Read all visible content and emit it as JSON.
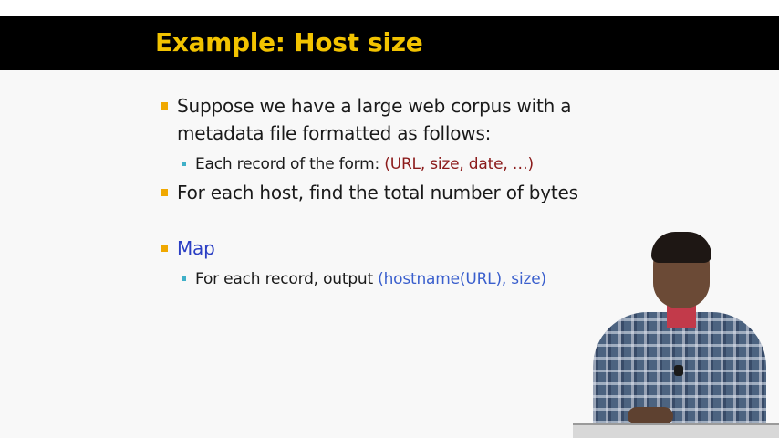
{
  "slide": {
    "title": "Example: Host size",
    "bullets": [
      {
        "line1": "Suppose we have a large web corpus with a",
        "line2": "metadata file formatted as follows:",
        "sub": {
          "text": "Each record of the form: ",
          "highlight": "(URL, size, date, …)"
        }
      },
      {
        "line1": "For each host, find the total number of bytes"
      },
      {
        "line1": "Map",
        "sub": {
          "text": "For each record, output ",
          "highlight": "(hostname(URL), size)"
        }
      }
    ]
  },
  "colors": {
    "title": "#f2c300",
    "title_bar": "#000000",
    "bullet": "#f0a800",
    "sub_bullet": "#3fb0c8",
    "highlight_maroon": "#8b1a1a",
    "highlight_blue": "#3a5fcd",
    "map_heading": "#2b3fc4"
  }
}
